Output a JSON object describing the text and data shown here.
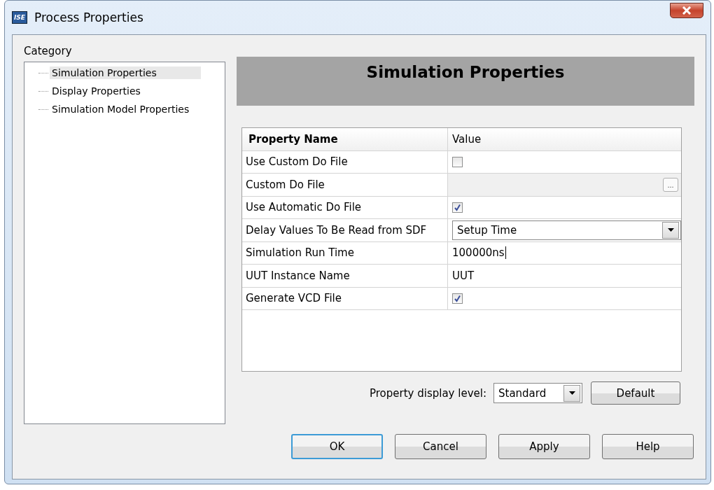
{
  "window": {
    "icon_text": "ISE",
    "title": "Process Properties"
  },
  "category": {
    "label": "Category",
    "items": [
      {
        "label": "Simulation Properties",
        "selected": true
      },
      {
        "label": "Display Properties",
        "selected": false
      },
      {
        "label": "Simulation Model Properties",
        "selected": false
      }
    ]
  },
  "header": "Simulation Properties",
  "grid": {
    "columns": [
      "Property Name",
      "Value"
    ],
    "rows": [
      {
        "kind": "checkbox",
        "name": "Use Custom Do File",
        "checked": false
      },
      {
        "kind": "file",
        "name": "Custom Do File",
        "disabled": true,
        "browse": "..."
      },
      {
        "kind": "checkbox",
        "name": "Use Automatic Do File",
        "checked": true
      },
      {
        "kind": "combo",
        "name": "Delay Values To Be Read from SDF",
        "value": "Setup Time"
      },
      {
        "kind": "text",
        "name": "Simulation Run Time",
        "value": "100000ns",
        "caret": true
      },
      {
        "kind": "text",
        "name": "UUT Instance Name",
        "value": "UUT",
        "caret": false
      },
      {
        "kind": "checkbox",
        "name": "Generate VCD File",
        "checked": true
      }
    ]
  },
  "display_level": {
    "label": "Property display level:",
    "value": "Standard"
  },
  "default_button": "Default",
  "buttons": [
    {
      "label": "OK",
      "focused": true
    },
    {
      "label": "Cancel",
      "focused": false
    },
    {
      "label": "Apply",
      "focused": false
    },
    {
      "label": "Help",
      "focused": false
    }
  ]
}
